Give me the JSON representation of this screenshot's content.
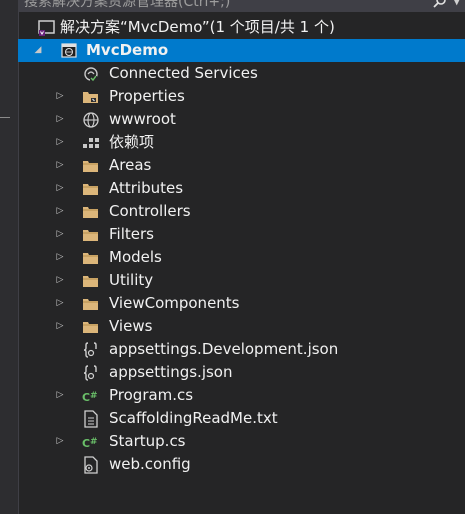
{
  "search": {
    "placeholder": "搜索解决方案资源管理器(Ctrl+;)"
  },
  "solution": {
    "label": "解决方案“MvcDemo”(1 个项目/共 1 个)"
  },
  "project": {
    "label": "MvcDemo"
  },
  "items": [
    {
      "label": "Connected Services",
      "icon": "connected-services-icon",
      "expandable": false
    },
    {
      "label": "Properties",
      "icon": "properties-folder-icon",
      "expandable": true
    },
    {
      "label": "wwwroot",
      "icon": "globe-icon",
      "expandable": true
    },
    {
      "label": "依赖项",
      "icon": "dependencies-icon",
      "expandable": true
    },
    {
      "label": "Areas",
      "icon": "folder-icon",
      "expandable": true
    },
    {
      "label": "Attributes",
      "icon": "folder-icon",
      "expandable": true
    },
    {
      "label": "Controllers",
      "icon": "folder-icon",
      "expandable": true
    },
    {
      "label": "Filters",
      "icon": "folder-icon",
      "expandable": true
    },
    {
      "label": "Models",
      "icon": "folder-icon",
      "expandable": true
    },
    {
      "label": "Utility",
      "icon": "folder-icon",
      "expandable": true
    },
    {
      "label": "ViewComponents",
      "icon": "folder-icon",
      "expandable": true
    },
    {
      "label": "Views",
      "icon": "folder-icon",
      "expandable": true
    },
    {
      "label": "appsettings.Development.json",
      "icon": "json-file-icon",
      "expandable": false
    },
    {
      "label": "appsettings.json",
      "icon": "json-file-icon",
      "expandable": false
    },
    {
      "label": "Program.cs",
      "icon": "csharp-file-icon",
      "expandable": true
    },
    {
      "label": "ScaffoldingReadMe.txt",
      "icon": "text-file-icon",
      "expandable": false
    },
    {
      "label": "Startup.cs",
      "icon": "csharp-file-icon",
      "expandable": true
    },
    {
      "label": "web.config",
      "icon": "config-file-icon",
      "expandable": false
    }
  ],
  "colors": {
    "background": "#252526",
    "selection": "#007acc",
    "folder": "#dcb67a",
    "csharp": "#6abf69"
  }
}
